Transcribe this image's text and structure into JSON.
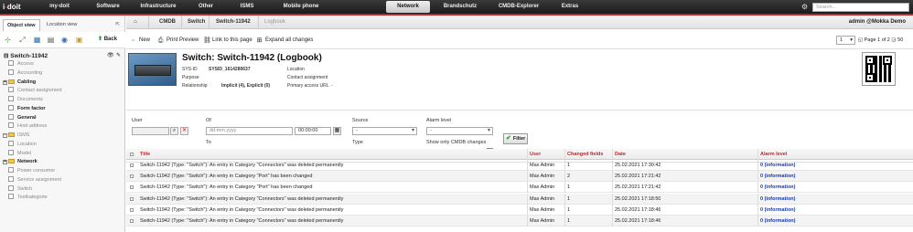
{
  "app": {
    "logo_text": "i-doit"
  },
  "topnav": [
    {
      "label": "my-doit",
      "active": false
    },
    {
      "label": "Software",
      "active": false
    },
    {
      "label": "Infrastructure",
      "active": false
    },
    {
      "label": "Other",
      "active": false
    },
    {
      "label": "ISMS",
      "active": false
    },
    {
      "label": "Mobile phone",
      "active": false
    },
    {
      "label": "Network",
      "active": true
    },
    {
      "label": "Brandschutz",
      "active": false
    },
    {
      "label": "CMDB-Explorer",
      "active": false
    },
    {
      "label": "Extras",
      "active": false
    }
  ],
  "search": {
    "placeholder": "Search..."
  },
  "left": {
    "tabs": [
      "Object view",
      "Location view"
    ],
    "back_label": "Back",
    "object_title": "Switch-11942",
    "tree": [
      {
        "label": "Access",
        "type": "page",
        "style": "grey",
        "expand": false
      },
      {
        "label": "Accounting",
        "type": "page",
        "style": "grey",
        "expand": false
      },
      {
        "label": "Cabling",
        "type": "folder",
        "style": "bold",
        "expand": true
      },
      {
        "label": "Contact assignment",
        "type": "page",
        "style": "grey",
        "expand": false
      },
      {
        "label": "Documents",
        "type": "page",
        "style": "grey",
        "expand": false
      },
      {
        "label": "Form factor",
        "type": "page",
        "style": "bold",
        "expand": false
      },
      {
        "label": "General",
        "type": "page",
        "style": "bold",
        "expand": false
      },
      {
        "label": "Host address",
        "type": "page",
        "style": "grey",
        "expand": false
      },
      {
        "label": "ISMS",
        "type": "folder",
        "style": "grey",
        "expand": true
      },
      {
        "label": "Location",
        "type": "page",
        "style": "grey",
        "expand": false
      },
      {
        "label": "Model",
        "type": "page",
        "style": "grey",
        "expand": false
      },
      {
        "label": "Network",
        "type": "folder",
        "style": "bold",
        "expand": true
      },
      {
        "label": "Power consumer",
        "type": "page",
        "style": "grey",
        "expand": false
      },
      {
        "label": "Service assignment",
        "type": "page",
        "style": "grey",
        "expand": false
      },
      {
        "label": "Switch",
        "type": "page",
        "style": "grey",
        "expand": false
      },
      {
        "label": "Testkategorie",
        "type": "page",
        "style": "grey",
        "expand": false
      }
    ]
  },
  "breadcrumb": [
    "CMDB",
    "Switch",
    "Switch-11942",
    "Logbook"
  ],
  "user_label": "admin @Mokka Demo",
  "toolbar": {
    "new": "New",
    "print": "Print Preview",
    "link": "Link to this page",
    "expand": "Expand all changes"
  },
  "pager": {
    "select_value": "1",
    "text": "Page 1 of 2",
    "count": "50"
  },
  "object": {
    "title": "Switch: Switch-11942 (Logbook)",
    "sysid_label": "SYS-ID",
    "sysid_value": "SYSID_1614280637",
    "purpose_label": "Purpose",
    "purpose_value": "",
    "relationship_label": "Relationship",
    "relationship_value": "Implicit (4), Explicit (0)",
    "location_label": "Location",
    "contact_label": "Contact assignment",
    "access_label": "Primary access URL",
    "access_value": "-"
  },
  "filters": {
    "user_label": "User",
    "of_label": "Of",
    "to_label": "To",
    "date_placeholder": "dd.mm.yyyy",
    "time_default": "00:00:00",
    "source_label": "Source",
    "source_value": "-",
    "type_label": "Type",
    "type_value": "-",
    "alarm_label": "Alarm level",
    "alarm_value": "-",
    "cmdb_only_label": "Show only CMDB changes",
    "filter_button": "Filter"
  },
  "table": {
    "headers": [
      "Title",
      "User",
      "Changed fields",
      "Date",
      "Alarm level"
    ],
    "rows": [
      [
        "Switch-11942 (Type: \"Switch\"): An entry in Category \"Connectors\" was deleted permanently",
        "Max Admin",
        "1",
        "25.02.2021 17:30:42",
        "0 (information)"
      ],
      [
        "Switch-11942 (Type: \"Switch\"): An entry in Category \"Port\" has been changed",
        "Max Admin",
        "2",
        "25.02.2021 17:21:42",
        "0 (information)"
      ],
      [
        "Switch-11942 (Type: \"Switch\"): An entry in Category \"Port\" has been changed",
        "Max Admin",
        "1",
        "25.02.2021 17:21:42",
        "0 (information)"
      ],
      [
        "Switch-11942 (Type: \"Switch\"): An entry in Category \"Connectors\" was deleted permanently",
        "Max Admin",
        "1",
        "25.02.2021 17:18:50",
        "0 (information)"
      ],
      [
        "Switch-11942 (Type: \"Switch\"): An entry in Category \"Connectors\" was deleted permanently",
        "Max Admin",
        "1",
        "25.02.2021 17:18:46",
        "0 (information)"
      ],
      [
        "Switch-11942 (Type: \"Switch\"): An entry in Category \"Connectors\" was deleted permanently",
        "Max Admin",
        "1",
        "25.02.2021 17:18:46",
        "0 (information)"
      ]
    ]
  },
  "colors": {
    "accent": "#c0282b",
    "alarm_link": "#1a3aa8",
    "topbar": "#2a2a2a"
  }
}
